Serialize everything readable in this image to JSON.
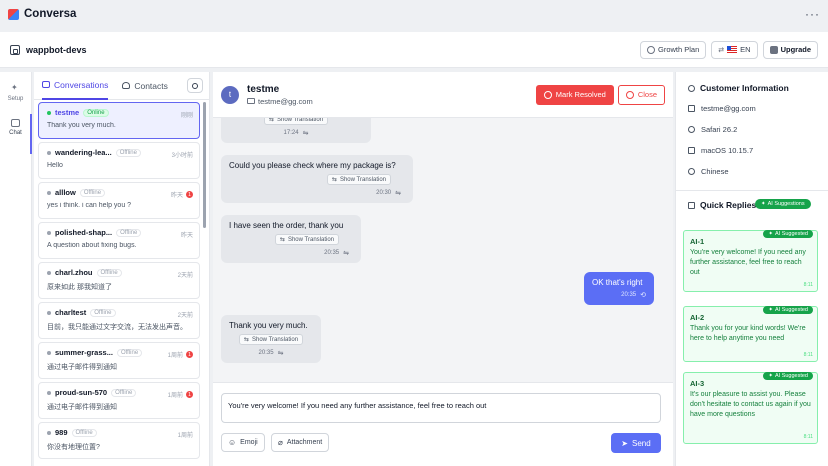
{
  "app": {
    "title": "Conversa",
    "more": "···"
  },
  "workspace": {
    "name": "wappbot-devs",
    "growth_plan": "Growth Plan",
    "language": "EN",
    "upgrade": "Upgrade"
  },
  "rail": {
    "setup": "Setup",
    "chat": "Chat"
  },
  "tabs": {
    "conversations": "Conversations",
    "contacts": "Contacts"
  },
  "conversations": [
    {
      "name": "testme",
      "status": "Online",
      "time": "刚刚",
      "message": "Thank you very much.",
      "badge": ""
    },
    {
      "name": "wandering-lea...",
      "status": "Offline",
      "time": "3小时前",
      "message": "Hello",
      "badge": ""
    },
    {
      "name": "alllow",
      "status": "Offline",
      "time": "昨天",
      "message": "yes i think. i can help you ?",
      "badge": "1"
    },
    {
      "name": "polished-shap...",
      "status": "Offline",
      "time": "昨天",
      "message": "A question about fixing bugs.",
      "badge": ""
    },
    {
      "name": "charl.zhou",
      "status": "Offline",
      "time": "2天前",
      "message": "原来如此 那我知道了",
      "badge": ""
    },
    {
      "name": "charltest",
      "status": "Offline",
      "time": "2天前",
      "message": "目前，我只能通过文字交流，无法发出声音。",
      "badge": ""
    },
    {
      "name": "summer-grass...",
      "status": "Offline",
      "time": "1周前",
      "message": "通过电子邮件得到通知",
      "badge": "1"
    },
    {
      "name": "proud-sun-570",
      "status": "Offline",
      "time": "1周前",
      "message": "通过电子邮件得到通知",
      "badge": "1"
    },
    {
      "name": "989",
      "status": "Offline",
      "time": "1周前",
      "message": "你没有地理位置?",
      "badge": ""
    }
  ],
  "chat": {
    "avatar_letter": "t",
    "name": "testme",
    "email": "testme@gg.com",
    "mark_resolved": "Mark Resolved",
    "close": "Close",
    "show_translation": "Show Translation",
    "messages": [
      {
        "text": "",
        "time": "17:24"
      },
      {
        "text": "Could you please check where my package is?",
        "time": "20:30"
      },
      {
        "text": "I have seen the order, thank you",
        "time": "20:35"
      },
      {
        "text": "OK that's right",
        "time": "20:35"
      },
      {
        "text": "Thank you very much.",
        "time": "20:35"
      }
    ],
    "composer_text": "You're very welcome! If you need any further assistance, feel free to reach out",
    "emoji": "Emoji",
    "attachment": "Attachment",
    "send": "Send"
  },
  "customer": {
    "title": "Customer Information",
    "email": "testme@gg.com",
    "browser": "Safari 26.2",
    "os": "macOS 10.15.7",
    "language": "Chinese"
  },
  "quick_replies": {
    "title": "Quick Replies",
    "ai_suggestions": "AI Suggestions",
    "ai_suggested": "AI Suggested",
    "items": [
      {
        "label": "AI-1",
        "text": "You're very welcome! If you need any further assistance, feel free to reach out",
        "time": "8:11"
      },
      {
        "label": "AI-2",
        "text": "Thank you for your kind words! We're here to help anytime you need",
        "time": "8:11"
      },
      {
        "label": "AI-3",
        "text": "It's our pleasure to assist you. Please don't hesitate to contact us again if you have more questions",
        "time": "8:11"
      }
    ]
  },
  "colors": {
    "accent": "#5b6ef5",
    "danger": "#ef4444",
    "ai_green": "#16a34a"
  }
}
